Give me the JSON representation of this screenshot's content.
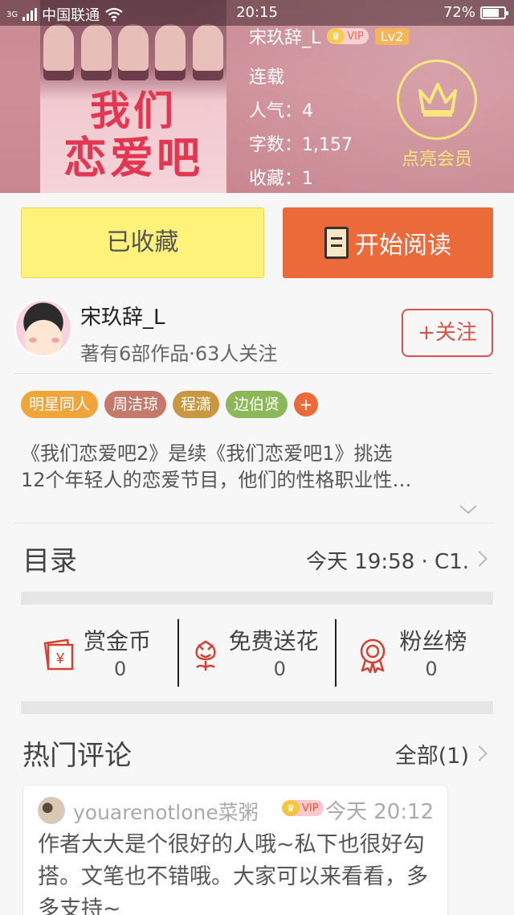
{
  "status_bar": {
    "carrier": "中国联通",
    "network_label": "3G",
    "time": "20:15",
    "battery": "72%"
  },
  "book": {
    "cover_title_line1": "我们",
    "cover_title_line2": "恋爱吧",
    "author": "宋玖辞_L",
    "vip_label": "VIP",
    "level": "Lv2",
    "status": "连载",
    "popularity_label": "人气：",
    "popularity": "4",
    "word_count_label": "字数：",
    "word_count": "1,157",
    "favorites_label": "收藏：",
    "favorites": "1"
  },
  "membership": {
    "label": "点亮会员"
  },
  "actions": {
    "collected_label": "已收藏",
    "read_label": "开始阅读"
  },
  "author_card": {
    "name": "宋玖辞_L",
    "meta": "著有6部作品·63人关注",
    "follow_label": "+关注"
  },
  "tags": [
    {
      "label": "明星同人",
      "color": "#f0a53a"
    },
    {
      "label": "周洁琼",
      "color": "#c47a6a"
    },
    {
      "label": "程潇",
      "color": "#c8973f"
    },
    {
      "label": "边伯贤",
      "color": "#8cb85a"
    }
  ],
  "tag_more": "+",
  "description": {
    "line1": "《我们恋爱吧2》是续《我们恋爱吧1》挑选",
    "line2": "12个年轻人的恋爱节目，他们的性格职业性…"
  },
  "toc": {
    "title": "目录",
    "latest": "今天 19:58 · C1."
  },
  "gifts": [
    {
      "label": "赏金币",
      "value": "0",
      "icon": "coin-envelope-icon"
    },
    {
      "label": "免费送花",
      "value": "0",
      "icon": "flower-icon"
    },
    {
      "label": "粉丝榜",
      "value": "0",
      "icon": "medal-icon"
    }
  ],
  "hot_comments": {
    "title": "热门评论",
    "all_label": "全部(1)"
  },
  "comment": {
    "user": "youarenotlone菜粥",
    "vip_label": "VIP",
    "time": "今天 20:12",
    "text": "作者大大是个很好的人哦~私下也很好勾搭。文笔也不错哦。大家可以来看看，多多支持~"
  },
  "colors": {
    "accent_orange": "#ec6a3a",
    "collect_yellow": "#fef27a",
    "follow_red": "#d9534a",
    "member_gold": "#f6e36a"
  }
}
